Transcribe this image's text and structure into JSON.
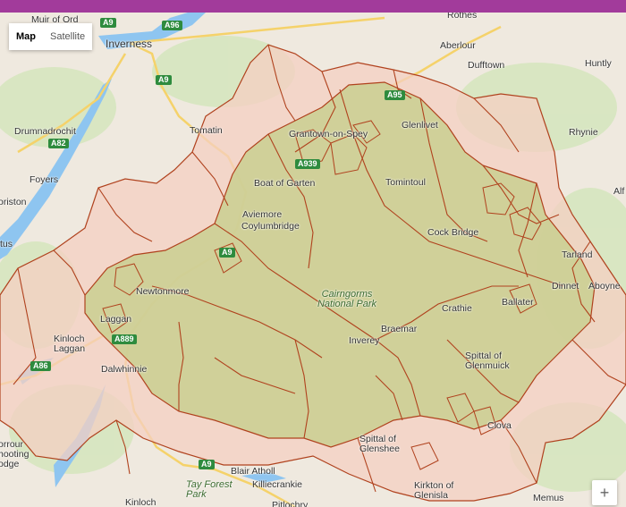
{
  "colors": {
    "topbar": "#a23b9b",
    "land": "#efe9df",
    "water": "#8ec5f0",
    "green": "#cfe3b5",
    "boundary": "#b0421e",
    "area_fill_green": "#c9cf91",
    "area_fill_pink": "#f4cfc2"
  },
  "map_type": {
    "map_label": "Map",
    "satellite_label": "Satellite",
    "active": "Map"
  },
  "zoom": {
    "in_label": "+"
  },
  "park_label": "Cairngorms\nNational Park",
  "places": {
    "muir_of_ord": "Muir of Ord",
    "inverness": "Inverness",
    "rothes": "Rothes",
    "aberlour": "Aberlour",
    "dufftown": "Dufftown",
    "huntly": "Huntly",
    "drumnadrochit": "Drumnadrochit",
    "tomatin": "Tomatin",
    "glenlivet": "Glenlivet",
    "rhynie": "Rhynie",
    "foyers": "Foyers",
    "grantown": "Grantown-on-Spey",
    "tomintoul": "Tomintoul",
    "boat_of_garten": "Boat of Garten",
    "alford": "Alf",
    "orriston": "oriston",
    "aviemore": "Aviemore",
    "coylumbridge": "Coylumbridge",
    "cock_bridge": "Cock Bridge",
    "tus": "tus",
    "tarland": "Tarland",
    "newtonmore": "Newtonmore",
    "dinnet": "Dinnet",
    "aboyne": "Aboyne",
    "crathie": "Crathie",
    "ballater": "Ballater",
    "laggan": "Laggan",
    "kinloch_laggan": "Kinloch\nLaggan",
    "braemar": "Braemar",
    "inverey": "Inverey",
    "dalwhinnie": "Dalwhinnie",
    "spittal_glenmuick": "Spittal of\nGlenmuick",
    "clova": "Clova",
    "torrour": "orrour\nhooting\nodge",
    "spittal_glenshee": "Spittal of\nGlenshee",
    "blair_atholl": "Blair Atholl",
    "killiecrankie": "Killiecrankie",
    "tay_forest": "Tay Forest\nPark",
    "kirkton": "Kirkton of\nGlenisla",
    "memus": "Memus",
    "kinloch": "Kinloch",
    "pitlochry": "Pitlochry"
  },
  "roads": {
    "a9_top": "A9",
    "a96": "A96",
    "a9_mid": "A9",
    "a82": "A82",
    "a95": "A95",
    "a939": "A939",
    "a9_av": "A9",
    "a86": "A86",
    "a889": "A889",
    "a9_bot": "A9"
  }
}
